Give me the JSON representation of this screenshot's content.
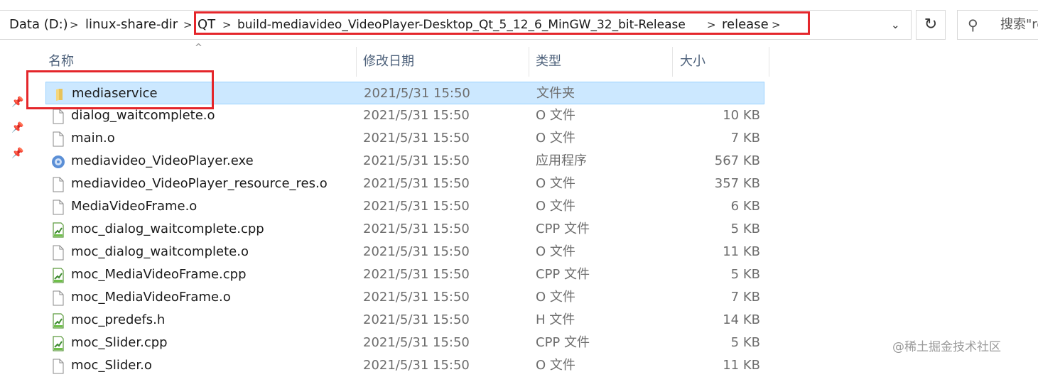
{
  "breadcrumb": {
    "items": [
      "Data (D:)",
      "linux-share-dir",
      "QT",
      "build-mediavideo_VideoPlayer-Desktop_Qt_5_12_6_MinGW_32_bit-Release",
      "release"
    ],
    "separator": ">",
    "history_dropdown": "⌄"
  },
  "toolbar": {
    "refresh_glyph": "↻"
  },
  "search": {
    "placeholder": "搜索\"re"
  },
  "columns": {
    "name": "名称",
    "date": "修改日期",
    "type": "类型",
    "size": "大小"
  },
  "files": [
    {
      "name": "mediaservice",
      "date": "2021/5/31 15:50",
      "type": "文件夹",
      "size": "",
      "icon": "folder-icon"
    },
    {
      "name": "dialog_waitcomplete.o",
      "date": "2021/5/31 15:50",
      "type": "O 文件",
      "size": "10 KB",
      "icon": "file-icon"
    },
    {
      "name": "main.o",
      "date": "2021/5/31 15:50",
      "type": "O 文件",
      "size": "7 KB",
      "icon": "file-icon"
    },
    {
      "name": "mediavideo_VideoPlayer.exe",
      "date": "2021/5/31 15:50",
      "type": "应用程序",
      "size": "567 KB",
      "icon": "exe-icon"
    },
    {
      "name": "mediavideo_VideoPlayer_resource_res.o",
      "date": "2021/5/31 15:50",
      "type": "O 文件",
      "size": "357 KB",
      "icon": "file-icon"
    },
    {
      "name": "MediaVideoFrame.o",
      "date": "2021/5/31 15:50",
      "type": "O 文件",
      "size": "6 KB",
      "icon": "file-icon"
    },
    {
      "name": "moc_dialog_waitcomplete.cpp",
      "date": "2021/5/31 15:50",
      "type": "CPP 文件",
      "size": "5 KB",
      "icon": "cpp-icon"
    },
    {
      "name": "moc_dialog_waitcomplete.o",
      "date": "2021/5/31 15:50",
      "type": "O 文件",
      "size": "11 KB",
      "icon": "file-icon"
    },
    {
      "name": "moc_MediaVideoFrame.cpp",
      "date": "2021/5/31 15:50",
      "type": "CPP 文件",
      "size": "5 KB",
      "icon": "cpp-icon"
    },
    {
      "name": "moc_MediaVideoFrame.o",
      "date": "2021/5/31 15:50",
      "type": "O 文件",
      "size": "7 KB",
      "icon": "file-icon"
    },
    {
      "name": "moc_predefs.h",
      "date": "2021/5/31 15:50",
      "type": "H 文件",
      "size": "14 KB",
      "icon": "cpp-icon"
    },
    {
      "name": "moc_Slider.cpp",
      "date": "2021/5/31 15:50",
      "type": "CPP 文件",
      "size": "5 KB",
      "icon": "cpp-icon"
    },
    {
      "name": "moc_Slider.o",
      "date": "2021/5/31 15:50",
      "type": "O 文件",
      "size": "11 KB",
      "icon": "file-icon"
    }
  ],
  "watermark": "@稀土掘金技术社区",
  "colors": {
    "highlight_box": "#e4262b",
    "selected_row": "#cce8ff",
    "header_text": "#4c607a"
  }
}
